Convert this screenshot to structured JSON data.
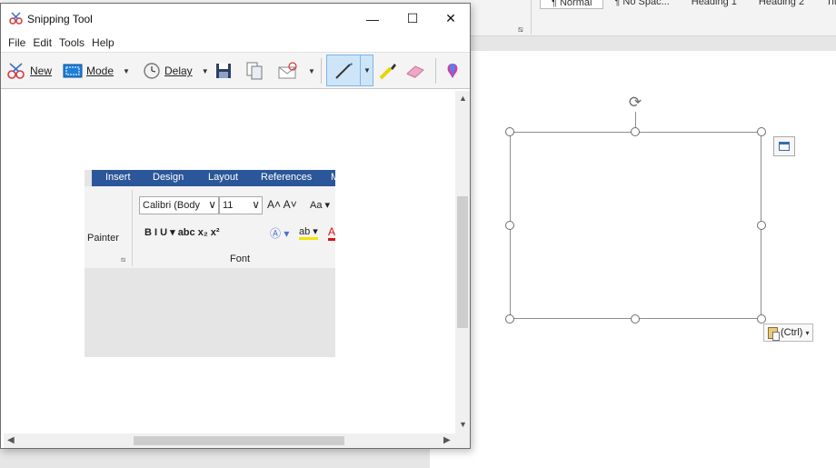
{
  "word": {
    "styles": [
      "¶ Normal",
      "¶ No Spac...",
      "Heading 1",
      "Heading 2",
      "Title"
    ],
    "paste_options_label": "(Ctrl)"
  },
  "snipping_tool": {
    "title": "Snipping Tool",
    "window_controls": {
      "minimize": "—",
      "maximize": "☐",
      "close": "✕"
    },
    "menu": [
      "File",
      "Edit",
      "Tools",
      "Help"
    ],
    "toolbar": {
      "new_label": "New",
      "mode_label": "Mode",
      "delay_label": "Delay"
    },
    "capture": {
      "tabs": [
        "Insert",
        "Design",
        "Layout",
        "References",
        "M"
      ],
      "painter_label": "Painter",
      "font_name": "Calibri (Body",
      "font_size": "11",
      "grow_shrink": "A˄ A˅",
      "change_case": "Aa ▾",
      "format_buttons": "B  I  U ▾ abc x₂ x²",
      "font_group_label": "Font"
    }
  },
  "colors": {
    "word_ribbon_blue": "#2b579a",
    "pen_selected_bg": "#cde5f7",
    "canvas_bg": "#ffffff"
  }
}
